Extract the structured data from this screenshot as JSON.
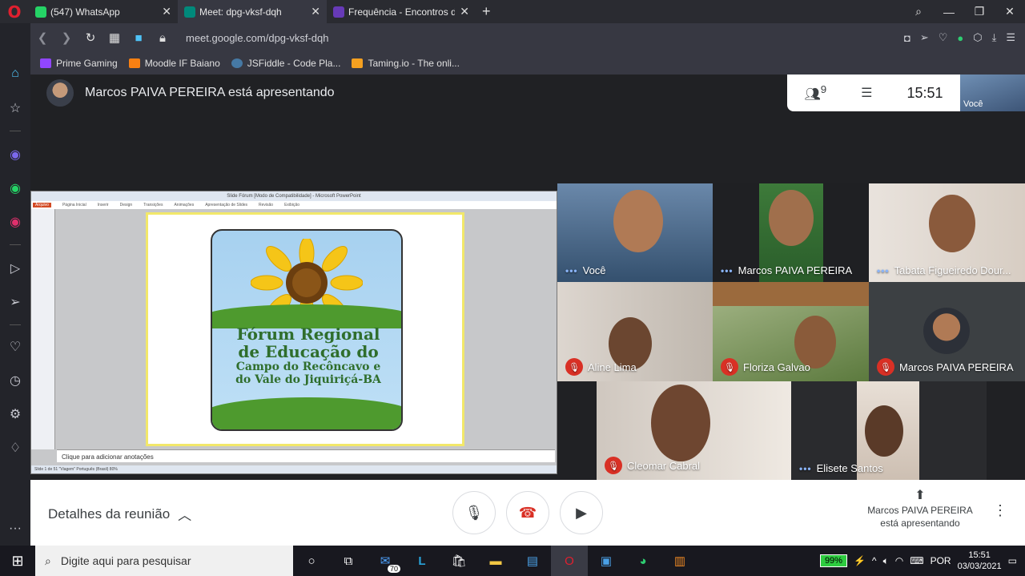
{
  "browser": {
    "tabs": [
      {
        "label": "(547) WhatsApp",
        "color": "#25d366"
      },
      {
        "label": "Meet: dpg-vksf-dqh",
        "color": "#00897b"
      },
      {
        "label": "Frequência - Encontros do ",
        "color": "#673ab7"
      }
    ],
    "url": "meet.google.com/dpg-vksf-dqh",
    "bookmarks": [
      {
        "label": "Prime Gaming",
        "color": "#9146ff"
      },
      {
        "label": "Moodle IF Baiano",
        "color": "#f98012"
      },
      {
        "label": "JSFiddle - Code Pla...",
        "color": "#4679a4"
      },
      {
        "label": "Taming.io - The onli...",
        "color": "#f4a020"
      }
    ]
  },
  "meet": {
    "presenter_banner": "Marcos PAIVA PEREIRA está apresentando",
    "participants_count": "9",
    "clock": "15:51",
    "self_label": "Você",
    "details_label": "Detalhes da reunião",
    "presenting_label": "Marcos PAIVA PEREIRA está apresentando"
  },
  "slide": {
    "window_title": "Slide Fórum [Modo de Compatibilidade] - Microsoft PowerPoint",
    "ribbon": [
      "Arquivo",
      "Página Inicial",
      "Inserir",
      "Design",
      "Transições",
      "Animações",
      "Apresentação de Slides",
      "Revisão",
      "Exibição"
    ],
    "logo_line1": "Fórum Regional",
    "logo_line2": "de Educação do",
    "logo_line3": "Campo do Recôncavo e",
    "logo_line4": "do Vale do Jiquiriçá-BA",
    "notes_placeholder": "Clique para adicionar anotações",
    "status": "Slide 1 de 51   \"Viagem\"   Português (Brasil)                                                                                                       80%"
  },
  "tiles": [
    {
      "name": "Você",
      "muted": false
    },
    {
      "name": "Marcos PAIVA PEREIRA",
      "muted": false
    },
    {
      "name": "Tabata Figueiredo Dour...",
      "muted": false
    },
    {
      "name": "Aline Lima",
      "muted": true
    },
    {
      "name": "Floriza Galvao",
      "muted": true
    },
    {
      "name": "Marcos PAIVA PEREIRA",
      "muted": true
    },
    {
      "name": "Cleomar Cabral",
      "muted": true
    },
    {
      "name": "Elisete Santos",
      "muted": false
    }
  ],
  "taskbar": {
    "search_placeholder": "Digite aqui para pesquisar",
    "mail_badge": "70",
    "battery": "99%",
    "lang": "POR",
    "time": "15:51",
    "date": "03/03/2021"
  }
}
